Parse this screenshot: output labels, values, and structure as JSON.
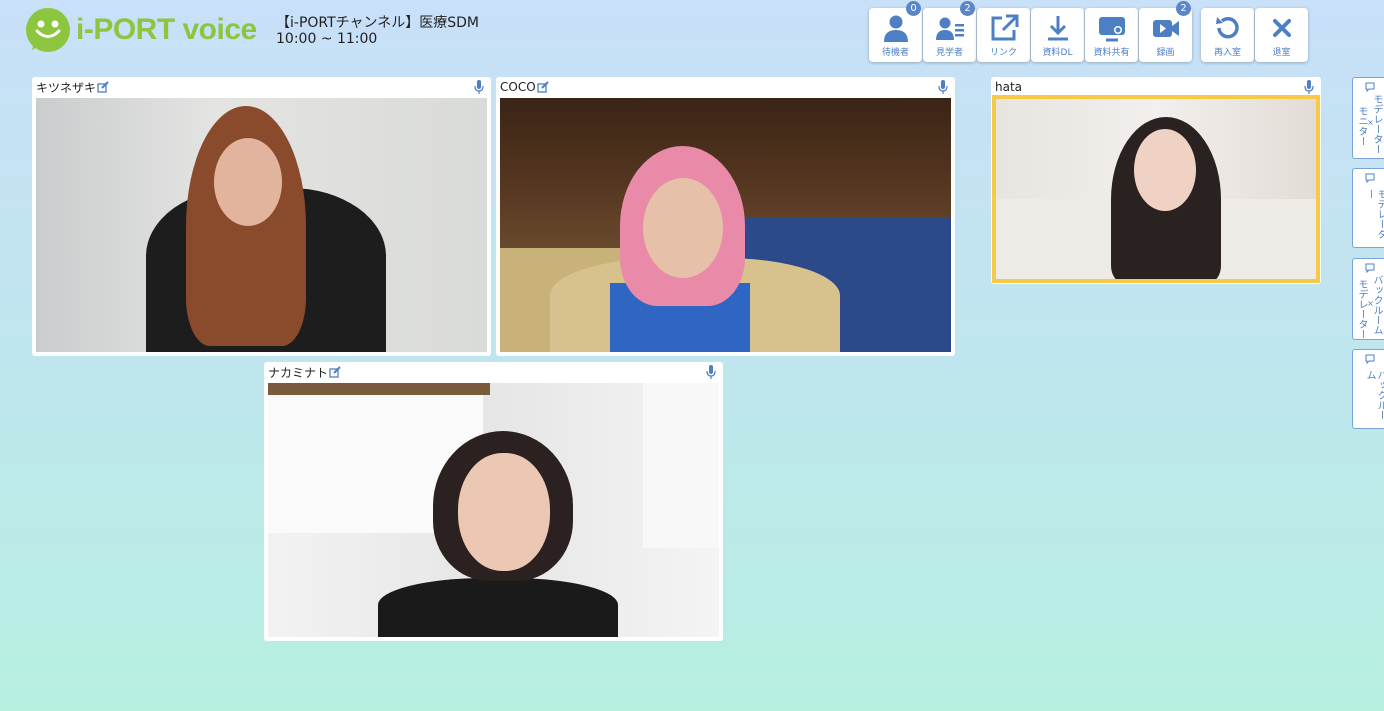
{
  "app": {
    "logo_text": "i-PORT voice"
  },
  "meeting": {
    "title": "【i-PORTチャンネル】医療SDM",
    "time": "10:00 ~ 11:00"
  },
  "toolbar": {
    "waiting": {
      "label": "待機者",
      "badge": "0"
    },
    "observers": {
      "label": "見学者",
      "badge": "2"
    },
    "link": {
      "label": "リンク"
    },
    "download": {
      "label": "資料DL"
    },
    "share": {
      "label": "資料共有"
    },
    "record": {
      "label": "録画",
      "badge": "2"
    },
    "reenter": {
      "label": "再入室"
    },
    "exit": {
      "label": "退室"
    }
  },
  "participants": [
    {
      "name": "キツネザキ"
    },
    {
      "name": "COCO"
    },
    {
      "name": "hata"
    },
    {
      "name": "ナカミナト"
    }
  ],
  "sidebar": {
    "tab1": {
      "line1": "モデレーター",
      "sep": "×",
      "line2": "モニター"
    },
    "tab2": {
      "label": "モデレーター"
    },
    "tab3": {
      "line1": "バックルーム",
      "sep": "×",
      "line2": "モデレーター"
    },
    "tab4": {
      "label": "バックルーム"
    }
  },
  "colors": {
    "accent": "#4d7fc4",
    "logo": "#8cc63f",
    "active_speaker": "#f7c948"
  }
}
